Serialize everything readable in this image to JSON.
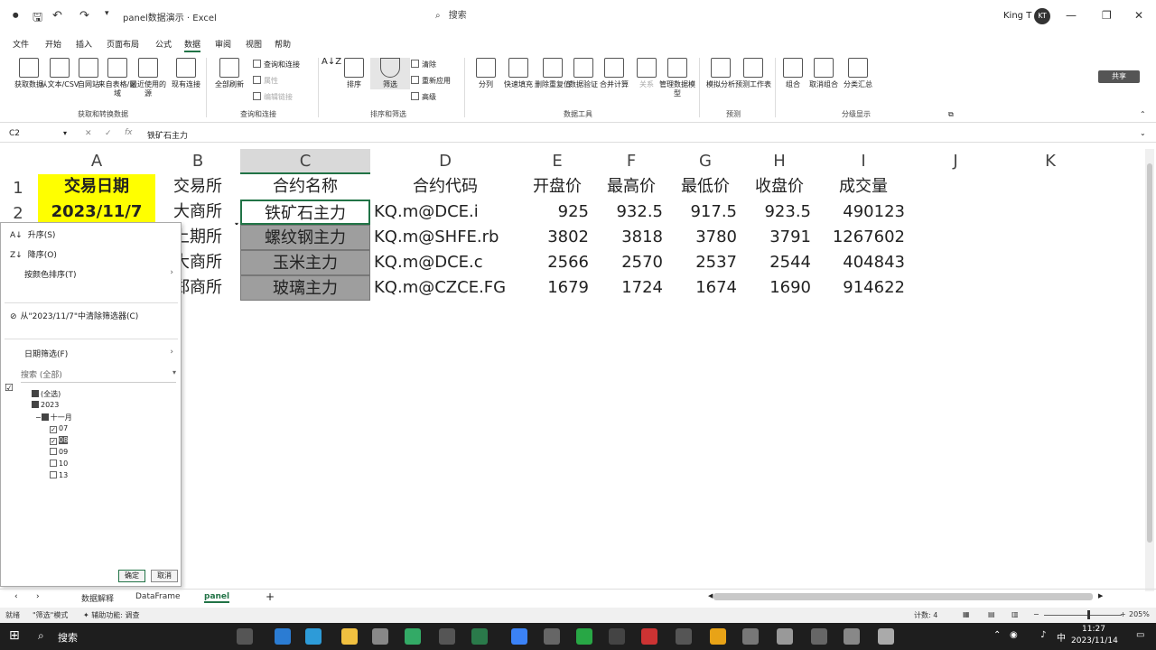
{
  "window": {
    "title": "panel数据演示 · Excel",
    "search_label": "搜索",
    "user_name": "King T",
    "avatar_initials": "KT"
  },
  "menu": {
    "items": [
      "文件",
      "开始",
      "插入",
      "页面布局",
      "公式",
      "数据",
      "审阅",
      "视图",
      "帮助"
    ],
    "share_label": "共享"
  },
  "ribbon": {
    "get_data": [
      "获取数据",
      "从文本/CSV",
      "自网站",
      "来自表格/区域",
      "最近使用的源",
      "现有连接"
    ],
    "refresh_all": "全部刷新",
    "queries_small": [
      "查询和连接",
      "属性",
      "编辑链接"
    ],
    "sort_filter": [
      "排序",
      "筛选"
    ],
    "filter_small": [
      "清除",
      "重新应用",
      "高级"
    ],
    "data_tools": [
      "分列",
      "快速填充",
      "删除重复值",
      "数据验证",
      "合并计算",
      "关系",
      "管理数据模型"
    ],
    "forecast": [
      "模拟分析",
      "预测工作表"
    ],
    "outline": [
      "组合",
      "取消组合",
      "分类汇总"
    ],
    "groups": [
      "获取和转换数据",
      "查询和连接",
      "排序和筛选",
      "数据工具",
      "预测",
      "分级显示"
    ]
  },
  "formula_bar": {
    "name_box": "C2",
    "formula": "铁矿石主力"
  },
  "grid": {
    "columns": [
      "A",
      "B",
      "C",
      "D",
      "E",
      "F",
      "G",
      "H",
      "I",
      "J",
      "K"
    ],
    "rows": [
      "1",
      "2"
    ],
    "header_row": [
      "交易日期",
      "交易所",
      "合约名称",
      "合约代码",
      "开盘价",
      "最高价",
      "最低价",
      "收盘价",
      "成交量"
    ],
    "data": [
      {
        "date": "2023/11/7",
        "exchange": "大商所",
        "name": "铁矿石主力",
        "code": "KQ.m@DCE.i",
        "open": "925",
        "high": "932.5",
        "low": "917.5",
        "close": "923.5",
        "volume": "490123"
      },
      {
        "date": "",
        "exchange": "上期所",
        "name": "螺纹钢主力",
        "code": "KQ.m@SHFE.rb",
        "open": "3802",
        "high": "3818",
        "low": "3780",
        "close": "3791",
        "volume": "1267602"
      },
      {
        "date": "",
        "exchange": "大商所",
        "name": "玉米主力",
        "code": "KQ.m@DCE.c",
        "open": "2566",
        "high": "2570",
        "low": "2537",
        "close": "2544",
        "volume": "404843"
      },
      {
        "date": "",
        "exchange": "郑商所",
        "name": "玻璃主力",
        "code": "KQ.m@CZCE.FG",
        "open": "1679",
        "high": "1724",
        "low": "1674",
        "close": "1690",
        "volume": "914622"
      }
    ]
  },
  "filter_panel": {
    "sort_asc": "升序(S)",
    "sort_desc": "降序(O)",
    "sort_by_color": "按颜色排序(T)",
    "clear_filter": "从\"2023/11/7\"中清除筛选器(C)",
    "date_filters": "日期筛选(F)",
    "search_placeholder": "搜索 (全部)",
    "tree": [
      "(全选)",
      "2023",
      "十一月",
      "07",
      "08",
      "09",
      "10",
      "13"
    ],
    "ok": "确定",
    "cancel": "取消"
  },
  "sheets": [
    "数据解释",
    "DataFrame",
    "panel"
  ],
  "status": {
    "ready": "就绪",
    "mode": "\"筛选\"模式",
    "accessibility": "辅助功能: 调查",
    "count": "计数: 4",
    "zoom": "205%"
  },
  "taskbar": {
    "search": "搜索",
    "time": "11:27",
    "date": "2023/11/14",
    "ime": "中"
  }
}
